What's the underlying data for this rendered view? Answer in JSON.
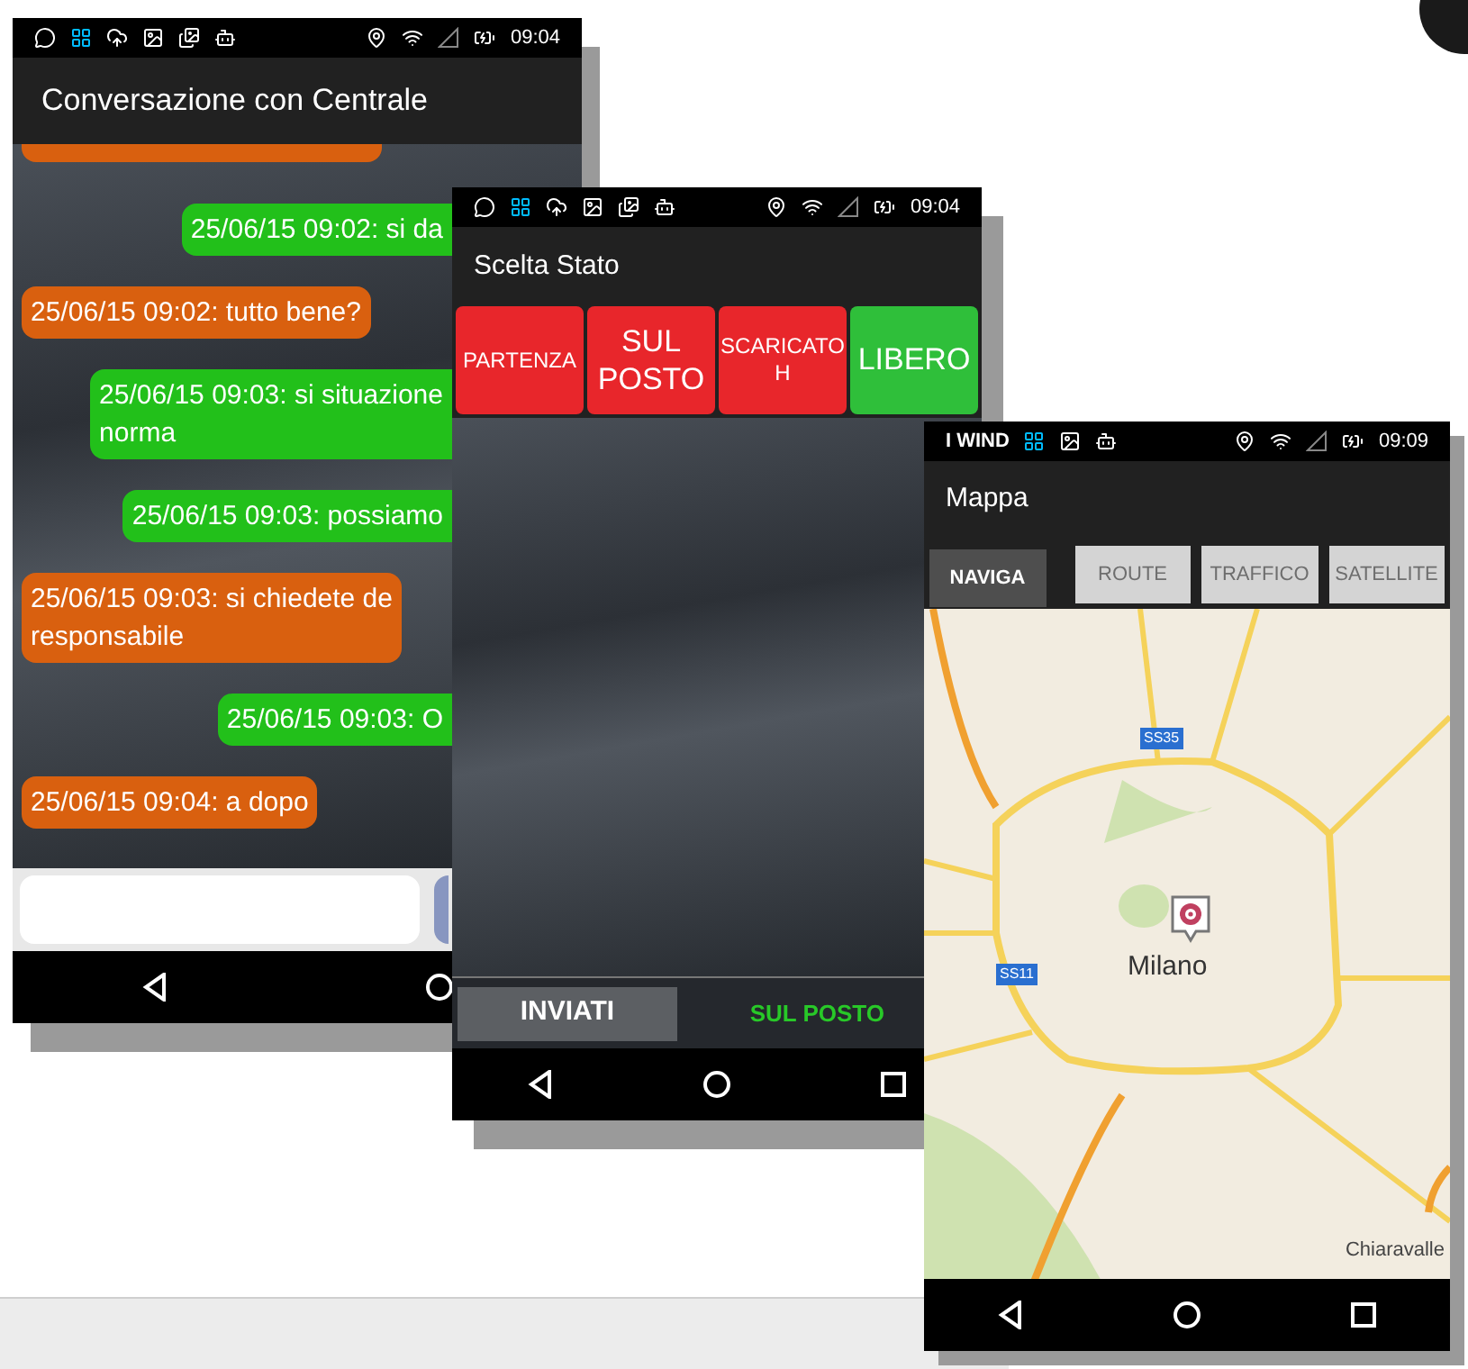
{
  "chat_screen": {
    "time": "09:04",
    "title": "Conversazione con Centrale",
    "messages": [
      {
        "kind": "sent",
        "lines": [
          "25/06/15 09:02: si da"
        ]
      },
      {
        "kind": "received",
        "lines": [
          "25/06/15 09:02: tutto bene?"
        ]
      },
      {
        "kind": "sent",
        "lines": [
          "25/06/15 09:03: si situazione",
          "norma"
        ]
      },
      {
        "kind": "sent",
        "lines": [
          "25/06/15 09:03: possiamo"
        ]
      },
      {
        "kind": "received",
        "lines": [
          "25/06/15 09:03: si chiedete de",
          "responsabile"
        ]
      },
      {
        "kind": "sent",
        "lines": [
          "25/06/15 09:03: O"
        ]
      },
      {
        "kind": "received",
        "lines": [
          "25/06/15 09:04: a dopo"
        ]
      }
    ]
  },
  "status_screen": {
    "time": "09:04",
    "title": "Scelta Stato",
    "status_buttons": [
      {
        "lines": [
          "PARTENZA"
        ],
        "color": "#e8262b"
      },
      {
        "lines": [
          "SUL",
          "POSTO"
        ],
        "color": "#e8262b"
      },
      {
        "lines": [
          "SCARICATO",
          "H"
        ],
        "color": "#e8262b"
      },
      {
        "lines": [
          "LIBERO"
        ],
        "color": "#2fbf3a"
      }
    ],
    "sent_button": "INVIATI",
    "current_status": "SUL POSTO"
  },
  "map_screen": {
    "carrier": "I WIND",
    "time": "09:09",
    "title": "Mappa",
    "map_tabs": [
      {
        "label": "NAVIGA",
        "selected": true
      },
      {
        "label": "ROUTE",
        "selected": false
      },
      {
        "label": "TRAFFICO",
        "selected": false
      },
      {
        "label": "SATELLITE",
        "selected": false
      }
    ],
    "city": "Milano",
    "road_shields": [
      "SS35",
      "SS11"
    ],
    "town": "Chiaravalle"
  }
}
